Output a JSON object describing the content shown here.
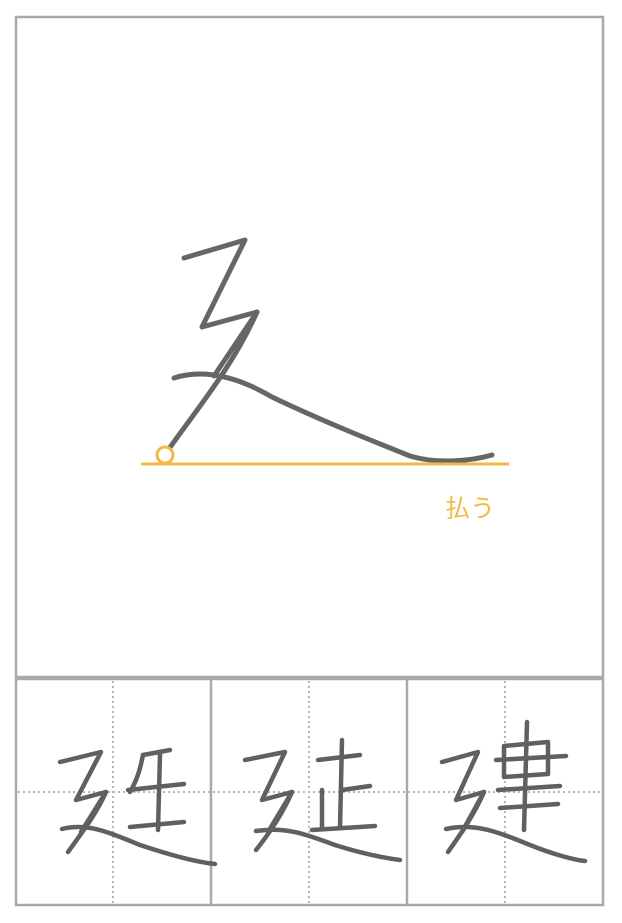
{
  "main_panel": {
    "component_name": "廴 (えんにょう)",
    "stroke_note": "払う",
    "accent_color": "#f4b942"
  },
  "examples": [
    {
      "kanji": "廷"
    },
    {
      "kanji": "延"
    },
    {
      "kanji": "建"
    }
  ]
}
